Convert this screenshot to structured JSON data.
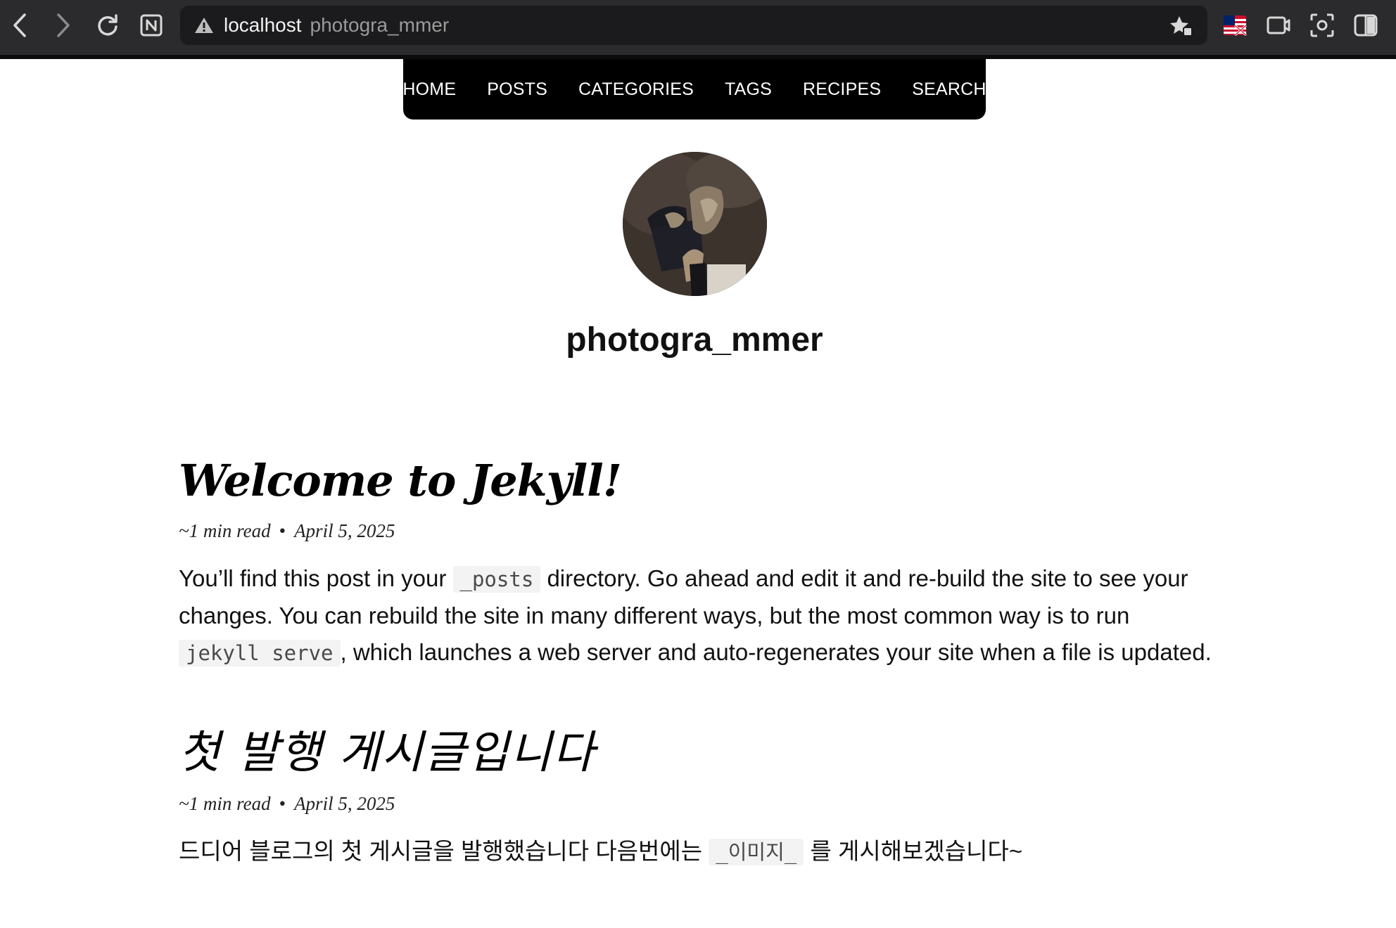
{
  "browser": {
    "host": "localhost",
    "path": "photogra_mmer"
  },
  "nav": {
    "items": [
      "HOME",
      "POSTS",
      "CATEGORIES",
      "TAGS",
      "RECIPES",
      "SEARCH"
    ]
  },
  "profile": {
    "site_title": "photogra_mmer"
  },
  "posts": [
    {
      "title": "Welcome to Jekyll!",
      "read_time": "~1 min read",
      "date": "April 5, 2025",
      "excerpt_1": "You’ll find this post in your ",
      "code_1": "_posts",
      "excerpt_2": " directory. Go ahead and edit it and re-build the site to see your changes. You can rebuild the site in many different ways, but the most common way is to run ",
      "code_2": "jekyll serve",
      "excerpt_3": ", which launches a web server and auto-regenerates your site when a file is updated."
    },
    {
      "title": "첫 발행 게시글입니다",
      "read_time": "~1 min read",
      "date": "April 5, 2025",
      "excerpt_1": "드디어 블로그의 첫 게시글을 발행했습니다 다음번에는 ",
      "code_1": "_이미지_",
      "excerpt_2": " 를 게시해보겠습니다~"
    }
  ],
  "meta_separator": "•",
  "colors": {
    "chrome_bg": "#2b2b2d",
    "address_bg": "#1b1b1d",
    "nav_bg": "#000000",
    "code_bg": "#f3f3f3"
  },
  "icons": [
    "back-icon",
    "forward-icon",
    "reload-icon",
    "notion-icon",
    "warning-icon",
    "star-extensions-icon",
    "flag-icon",
    "video-icon",
    "screenshot-icon",
    "sidebar-icon"
  ]
}
